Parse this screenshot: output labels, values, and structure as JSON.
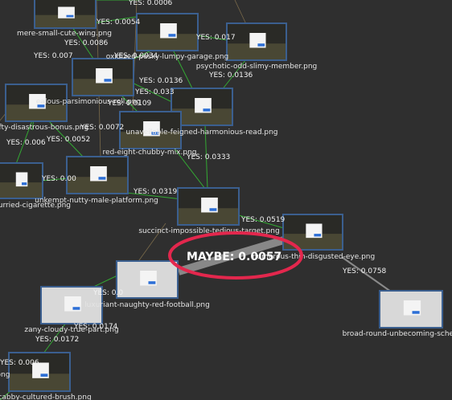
{
  "nodes": [
    {
      "id": "mere",
      "label": "mere-small-cute-wing.png",
      "theme": "dark"
    },
    {
      "id": "garage",
      "label": "oxidized-pesky-lumpy-garage.png",
      "theme": "dark"
    },
    {
      "id": "psycho",
      "label": "psychotic-odd-slimy-member.png",
      "theme": "dark"
    },
    {
      "id": "parsi",
      "label": "ealous-parsimonious-roll.png",
      "theme": "dark"
    },
    {
      "id": "center",
      "label": "",
      "theme": "dark"
    },
    {
      "id": "harm",
      "label": "unaveilable-feigned-harmonious-read.png",
      "theme": "dark"
    },
    {
      "id": "nifty",
      "label": "y-nifty-disastrous-bonus.png",
      "theme": "dark"
    },
    {
      "id": "red8",
      "label": "red-eight-chubby-mix.png",
      "theme": "dark"
    },
    {
      "id": "hurried",
      "label": "hurried-cigarette.png",
      "theme": "dark"
    },
    {
      "id": "unkempt",
      "label": "unkempt-nutty-male-platform.png",
      "theme": "dark"
    },
    {
      "id": "succinct",
      "label": "succinct-impossible-tedious-target.png",
      "theme": "dark"
    },
    {
      "id": "numerous",
      "label": "numerous-thin-disgusted-eye.png",
      "theme": "dark"
    },
    {
      "id": "broad",
      "label": "broad-round-unbecoming-scheme.png",
      "theme": "light"
    },
    {
      "id": "football",
      "label": "luxuriant-naughty-red-football.png",
      "theme": "light"
    },
    {
      "id": "zany",
      "label": "zany-cloudy-true-part.png",
      "theme": "light"
    },
    {
      "id": "scabby",
      "label": "y-scabby-cultured-brush.png",
      "theme": "dark"
    },
    {
      "id": "ong",
      "label": "ong",
      "theme": "dark"
    }
  ],
  "edges": [
    {
      "from": "succinct",
      "to": "numerous",
      "label": "MAYBE: 0.0057",
      "kind": "maybe"
    },
    {
      "from": "numerous",
      "to": "broad",
      "label": "YES: 0.0758",
      "kind": "yes-gray"
    },
    {
      "from": "succinct",
      "to": "numerous",
      "label": "YES: 0.0519",
      "kind": "yes"
    },
    {
      "from": "unkempt",
      "to": "succinct",
      "label": "YES: 0.0319",
      "kind": "yes"
    },
    {
      "from": "red8",
      "to": "succinct",
      "label": "YES: 0.0333",
      "kind": "yes"
    },
    {
      "from": "harm",
      "to": "succinct",
      "label": "",
      "kind": "yes"
    },
    {
      "from": "harm",
      "to": "psycho",
      "label": "YES: 0.0136",
      "kind": "yes"
    },
    {
      "from": "garage",
      "to": "psycho",
      "label": "YES: 0.017",
      "kind": "yes"
    },
    {
      "from": "garage",
      "to": "harm",
      "label": "YES: 0.0136",
      "kind": "yes"
    },
    {
      "from": "center",
      "to": "harm",
      "label": "YES: 0.033",
      "kind": "yes"
    },
    {
      "from": "parsi",
      "to": "nifty",
      "label": "YES: 0.007",
      "kind": "yes"
    },
    {
      "from": "mere",
      "to": "garage",
      "label": "YES: 0.0054",
      "kind": "yes"
    },
    {
      "from": "mere",
      "to": "center",
      "label": "YES: 0.0086",
      "kind": "yes"
    },
    {
      "from": "nifty",
      "to": "unkempt",
      "label": "YES: 0.0052",
      "kind": "yes"
    },
    {
      "from": "nifty",
      "to": "hurried",
      "label": "YES: 0.006",
      "kind": "yes"
    },
    {
      "from": "red8",
      "to": "harm",
      "label": "YES: 0.0072",
      "kind": "yes"
    },
    {
      "from": "center",
      "to": "garage",
      "label": "YES: 0.0034",
      "kind": "yes"
    },
    {
      "from": "football",
      "to": "zany",
      "label": "YES: 0.0",
      "kind": "yes"
    },
    {
      "from": "zany",
      "to": "scabby",
      "label": "YES: 0.0172",
      "kind": "yes"
    },
    {
      "from": "unkempt",
      "to": "hurried",
      "label": "YES: 0.00",
      "kind": "yes"
    },
    {
      "from": "center",
      "to": "red8",
      "label": "YES: 0.0109",
      "kind": "yes"
    },
    {
      "from": "mere",
      "to": "psycho",
      "label": "YES: 0.0006",
      "kind": "yes"
    },
    {
      "from": "football",
      "to": "zany",
      "label": "YES: 0.0174",
      "kind": "yes"
    },
    {
      "from": "scabby",
      "to": "ong",
      "label": "YES: 0.006",
      "kind": "yes"
    }
  ]
}
